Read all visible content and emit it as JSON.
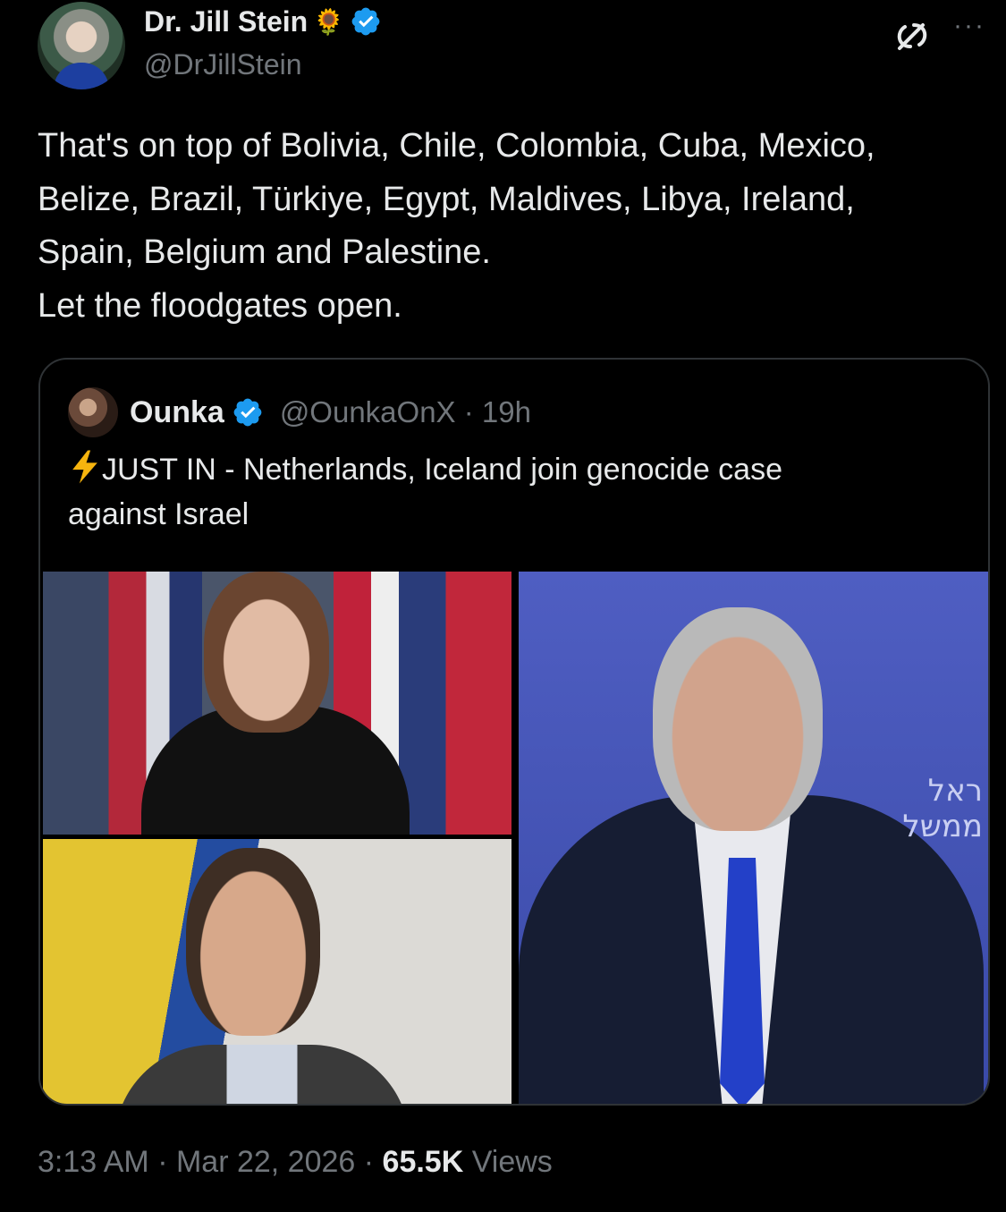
{
  "author": {
    "display_name": "Dr. Jill Stein",
    "emoji": "🌻",
    "handle": "@DrJillStein"
  },
  "tweet": {
    "lines": [
      "That's on top of Bolivia, Chile, Colombia, Cuba, Mexico,",
      "Belize, Brazil, Türkiye, Egypt, Maldives, Libya, Ireland,",
      "Spain, Belgium and Palestine.",
      "Let the floodgates open."
    ]
  },
  "quote": {
    "display_name": "Ounka",
    "handle_time": "@OunkaOnX · 19h",
    "text_line1": "JUST IN - Netherlands, Iceland join genocide case",
    "text_line2": "against Israel",
    "image_text": "ראל\nממשל"
  },
  "footer": {
    "time_date": "3:13 AM · Mar 22, 2026 · ",
    "views_count": "65.5K",
    "views_label": " Views"
  },
  "icons": {
    "verified": "verified-badge-icon",
    "grok": "grok-icon",
    "more": "more-icon",
    "bolt": "lightning-icon"
  },
  "colors": {
    "background": "#000000",
    "text": "#e7e9ea",
    "muted": "#71767b",
    "verified_blue": "#1d9bf0",
    "border": "#2f3336"
  }
}
